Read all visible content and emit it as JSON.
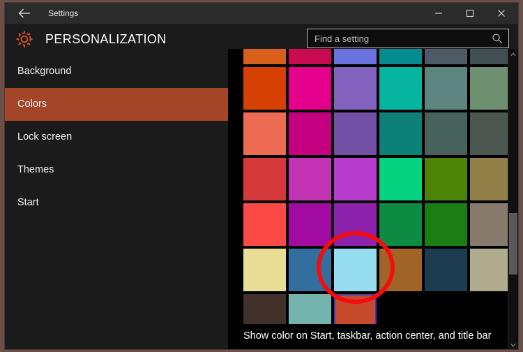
{
  "window": {
    "title": "Settings",
    "border_color": "#6d4f4a",
    "background": "#1b1b1b"
  },
  "titlebar": {
    "back_label": "back-arrow",
    "minimize_label": "Minimize",
    "maximize_label": "Maximize",
    "close_label": "Close"
  },
  "header": {
    "title": "PERSONALIZATION",
    "icon": "gear-icon",
    "icon_color": "#e2541f"
  },
  "search": {
    "placeholder": "Find a setting",
    "value": "",
    "icon": "search-icon"
  },
  "sidebar": {
    "items": [
      {
        "label": "Background",
        "selected": false
      },
      {
        "label": "Colors",
        "selected": true
      },
      {
        "label": "Lock screen",
        "selected": false
      },
      {
        "label": "Themes",
        "selected": false
      },
      {
        "label": "Start",
        "selected": false
      }
    ],
    "selected_color": "#a34526"
  },
  "content": {
    "bottom_label": "Show color on Start, taskbar, action center, and title bar",
    "selected_swatch": {
      "row": 6,
      "col": 2,
      "color": "#c74a2c"
    },
    "swatch_rows": [
      [
        "#d9601b",
        "#c70a51",
        "#6b73e0",
        "#068b8f",
        "#4e5a66",
        "#414f55"
      ],
      [
        "#d74003",
        "#e4008c",
        "#8362bf",
        "#06b5a0",
        "#5c8580",
        "#6f8f71"
      ],
      [
        "#ed6a53",
        "#c40081",
        "#7150a5",
        "#0c8079",
        "#47615d",
        "#4b5750"
      ],
      [
        "#d6393c",
        "#c334b5",
        "#b53ccd",
        "#05d37f",
        "#4b8406",
        "#918149"
      ],
      [
        "#fe4a46",
        "#a20ba2",
        "#8d23ad",
        "#0e8b43",
        "#1b7e15",
        "#857a6b"
      ],
      [
        "#e9dd96",
        "#336e9f",
        "#96ddf0",
        "#a06526",
        "#1e3c50",
        "#b0ac8e"
      ],
      [
        "#42302b",
        "#74b3ae",
        "#c74a2c",
        "",
        "",
        ""
      ]
    ]
  },
  "scrollbar": {
    "up_label": "scroll-up",
    "down_label": "scroll-down"
  },
  "annotation": {
    "shape": "circle",
    "color": "#f40d0d",
    "target": "light-blue swatch"
  }
}
